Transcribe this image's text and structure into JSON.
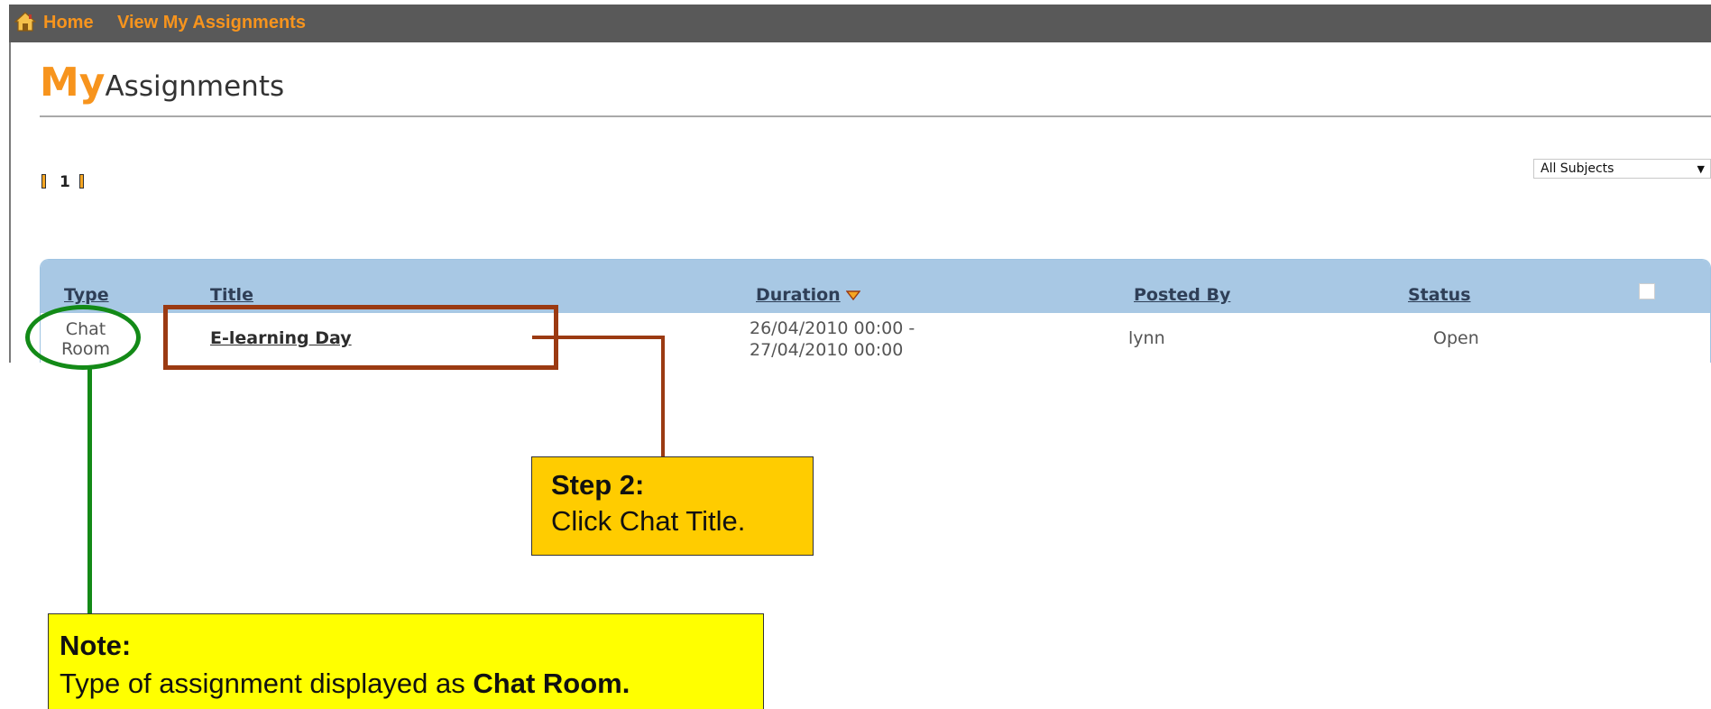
{
  "nav": {
    "home_label": "Home",
    "assignments_label": "View My Assignments",
    "home_icon": "home-icon"
  },
  "page": {
    "title_prefix": "My",
    "title_rest": "Assignments"
  },
  "pager": {
    "current_page": "1"
  },
  "filter": {
    "subject_selected": "All Subjects"
  },
  "table": {
    "headers": {
      "type": "Type",
      "title": "Title",
      "duration": "Duration",
      "posted_by": "Posted By",
      "status": "Status"
    },
    "rows": [
      {
        "type_line1": "Chat",
        "type_line2": "Room",
        "title": "E-learning Day",
        "duration_start": "26/04/2010 00:00 -",
        "duration_end": "27/04/2010 00:00",
        "posted_by": "lynn",
        "status": "Open"
      }
    ]
  },
  "annotations": {
    "step2_heading": "Step 2:",
    "step2_text": "Click Chat Title.",
    "note_heading": "Note:",
    "note_text": "Type of assignment displayed as ",
    "note_text_bold": "Chat Room."
  },
  "colors": {
    "accent_orange": "#f7941d",
    "topbar": "#595959",
    "table_header": "#a8c8e4",
    "circle_green": "#138a17",
    "rect_brown": "#9b3a12",
    "step_box": "#ffcc00",
    "note_box": "#ffff00"
  }
}
